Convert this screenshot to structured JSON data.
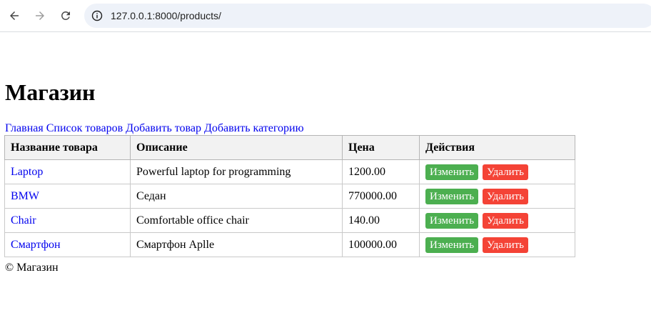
{
  "browser": {
    "url": "127.0.0.1:8000/products/"
  },
  "page": {
    "title": "Магазин",
    "nav": [
      {
        "label": "Главная"
      },
      {
        "label": "Список товаров"
      },
      {
        "label": "Добавить товар"
      },
      {
        "label": "Добавить категорию"
      }
    ],
    "table": {
      "headers": [
        "Название товара",
        "Описание",
        "Цена",
        "Действия"
      ],
      "rows": [
        {
          "name": "Laptop",
          "description": "Powerful laptop for programming",
          "price": "1200.00"
        },
        {
          "name": "BMW",
          "description": "Седан",
          "price": "770000.00"
        },
        {
          "name": "Chair",
          "description": "Comfortable office chair",
          "price": "140.00"
        },
        {
          "name": "Смартфон",
          "description": "Смартфон Aplle",
          "price": "100000.00"
        }
      ],
      "edit_label": "Изменить",
      "delete_label": "Удалить"
    },
    "footer": "© Магазин"
  },
  "colors": {
    "link": "#0000ee",
    "edit_button": "#4caf50",
    "delete_button": "#f44336",
    "header_bg": "#f2f2f2"
  }
}
